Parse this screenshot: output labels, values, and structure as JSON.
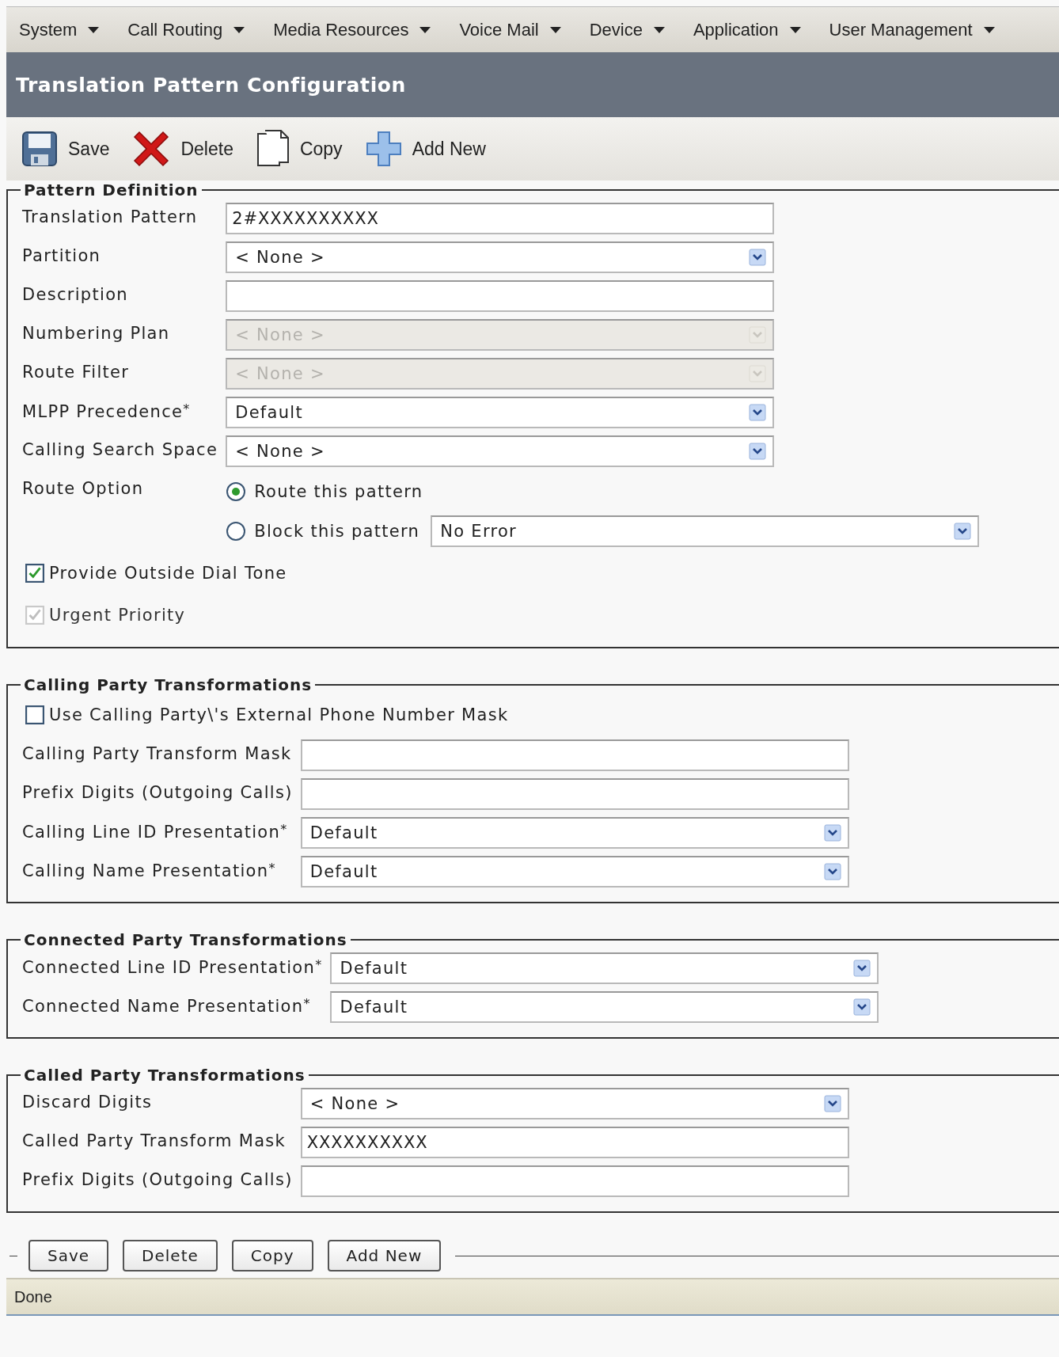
{
  "menu": [
    {
      "label": "System"
    },
    {
      "label": "Call Routing"
    },
    {
      "label": "Media Resources"
    },
    {
      "label": "Voice Mail"
    },
    {
      "label": "Device"
    },
    {
      "label": "Application"
    },
    {
      "label": "User Management"
    }
  ],
  "title": "Translation Pattern Configuration",
  "toolbar": [
    {
      "kind": "save",
      "label": "Save"
    },
    {
      "kind": "delete",
      "label": "Delete"
    },
    {
      "kind": "copy",
      "label": "Copy"
    },
    {
      "kind": "add",
      "label": "Add New"
    }
  ],
  "sections": [
    {
      "title": "Pattern Definition",
      "rows": [
        {
          "kind": "text",
          "label": "Translation Pattern",
          "value": "2#XXXXXXXXXX"
        },
        {
          "kind": "select",
          "label": "Partition",
          "value": "< None >",
          "disabled": false
        },
        {
          "kind": "text",
          "label": "Description"
        },
        {
          "kind": "select",
          "label": "Numbering Plan",
          "value": "< None >",
          "disabled": true
        },
        {
          "kind": "select",
          "label": "Route Filter",
          "value": "< None >",
          "disabled": true
        },
        {
          "kind": "select",
          "label": "MLPP Precedence",
          "required_mark": "*",
          "value": "Default",
          "disabled": false
        },
        {
          "kind": "select",
          "label": "Calling Search Space",
          "value": "< None >",
          "disabled": false
        },
        {
          "kind": "radio",
          "label": "Route Option",
          "options": [
            {
              "label": "Route this pattern",
              "selected": true
            },
            {
              "label": "Block this pattern",
              "selected": false,
              "select": {
                "value": "No Error",
                "disabled": false
              }
            }
          ]
        },
        {
          "kind": "checkbox",
          "label": "Provide Outside Dial Tone",
          "checked": true,
          "disabled": false
        },
        {
          "kind": "checkbox",
          "label": "Urgent Priority",
          "checked": true,
          "disabled": true
        }
      ]
    },
    {
      "title": "Calling Party Transformations",
      "rows": [
        {
          "kind": "checkbox",
          "label": "Use Calling Party\\'s External Phone Number Mask",
          "checked": false,
          "disabled": false
        },
        {
          "kind": "text",
          "label": "Calling Party Transform Mask"
        },
        {
          "kind": "text",
          "label": "Prefix Digits (Outgoing Calls)"
        },
        {
          "kind": "select",
          "label": "Calling Line ID Presentation",
          "required_mark": "*",
          "value": "Default",
          "disabled": false
        },
        {
          "kind": "select",
          "label": "Calling Name Presentation",
          "required_mark": "*",
          "value": "Default",
          "disabled": false
        }
      ]
    },
    {
      "title": "Connected Party Transformations",
      "rows": [
        {
          "kind": "select",
          "label": "Connected Line ID Presentation",
          "required_mark": "*",
          "value": "Default",
          "disabled": false
        },
        {
          "kind": "select",
          "label": "Connected Name Presentation",
          "required_mark": "*",
          "value": "Default",
          "disabled": false
        }
      ]
    },
    {
      "title": "Called Party Transformations",
      "rows": [
        {
          "kind": "select",
          "label": "Discard Digits",
          "value": "< None >",
          "disabled": false
        },
        {
          "kind": "text",
          "label": "Called Party Transform Mask",
          "value": "XXXXXXXXXX"
        },
        {
          "kind": "text",
          "label": "Prefix Digits (Outgoing Calls)"
        }
      ]
    }
  ],
  "buttons": [
    {
      "label": "Save"
    },
    {
      "label": "Delete"
    },
    {
      "label": "Copy"
    },
    {
      "label": "Add New"
    }
  ],
  "status_bar": "Done"
}
